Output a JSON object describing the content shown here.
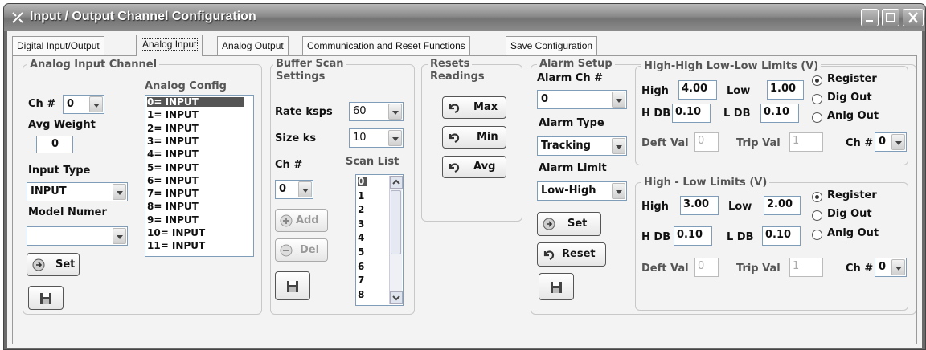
{
  "window": {
    "title": "Input / Output Channel Configuration"
  },
  "tabs": [
    "Digital Input/Output",
    "Analog Input",
    "Analog Output",
    "Communication and Reset Functions",
    "Save Configuration"
  ],
  "active_tab": "Analog Input",
  "analog_input_channel": {
    "title": "Analog Input Channel",
    "ch_label": "Ch #",
    "ch_value": "0",
    "avg_weight_label": "Avg Weight",
    "avg_weight_value": "0",
    "input_type_label": "Input Type",
    "input_type_value": "INPUT",
    "model_number_label": "Model Numer",
    "model_number_value": "",
    "set_label": "Set",
    "analog_config_label": "Analog Config",
    "analog_config_items": [
      "0= INPUT",
      "1= INPUT",
      "2= INPUT",
      "3= INPUT",
      "4= INPUT",
      "5= INPUT",
      "6= INPUT",
      "7= INPUT",
      "8= INPUT",
      "9= INPUT",
      "10= INPUT",
      "11= INPUT"
    ],
    "selected_config": "0= INPUT"
  },
  "buffer_scan": {
    "title_line1": "Buffer Scan",
    "title_line2": "Settings",
    "rate_label": "Rate ksps",
    "rate_value": "60",
    "size_label": "Size ks",
    "size_value": "10",
    "ch_label": "Ch #",
    "ch_value": "0",
    "scan_list_label": "Scan List",
    "scan_list_items": [
      "0",
      "1",
      "2",
      "3",
      "4",
      "5",
      "6",
      "7",
      "8"
    ],
    "add_label": "Add",
    "del_label": "Del"
  },
  "resets": {
    "title_line1": "Resets",
    "title_line2": "Readings",
    "max_label": "Max",
    "min_label": "Min",
    "avg_label": "Avg"
  },
  "alarm_setup": {
    "title": "Alarm Setup",
    "alarm_ch_label": "Alarm Ch #",
    "alarm_ch_value": "0",
    "alarm_type_label": "Alarm Type",
    "alarm_type_value": "Tracking",
    "alarm_limit_label": "Alarm Limit",
    "alarm_limit_value": "Low-High",
    "set_label": "Set",
    "reset_label": "Reset"
  },
  "hh_ll_limits": {
    "title": "High-High Low-Low Limits (V)",
    "high_label": "High",
    "high_value": "4.00",
    "low_label": "Low",
    "low_value": "1.00",
    "hdb_label": "H DB",
    "hdb_value": "0.10",
    "ldb_label": "L DB",
    "ldb_value": "0.10",
    "radio_register": "Register",
    "radio_dig_out": "Dig Out",
    "radio_anlg_out": "Anlg Out",
    "selected_radio": "Register",
    "deft_val_label": "Deft Val",
    "deft_val_value": "0",
    "trip_val_label": "Trip Val",
    "trip_val_value": "1",
    "ch_label": "Ch #",
    "ch_value": "0"
  },
  "hl_limits": {
    "title": "High - Low Limits (V)",
    "high_label": "High",
    "high_value": "3.00",
    "low_label": "Low",
    "low_value": "2.00",
    "hdb_label": "H DB",
    "hdb_value": "0.10",
    "ldb_label": "L DB",
    "ldb_value": "0.10",
    "radio_register": "Register",
    "radio_dig_out": "Dig Out",
    "radio_anlg_out": "Anlg Out",
    "selected_radio": "Register",
    "deft_val_label": "Deft Val",
    "deft_val_value": "0",
    "trip_val_label": "Trip Val",
    "trip_val_value": "1",
    "ch_label": "Ch #",
    "ch_value": "0"
  }
}
